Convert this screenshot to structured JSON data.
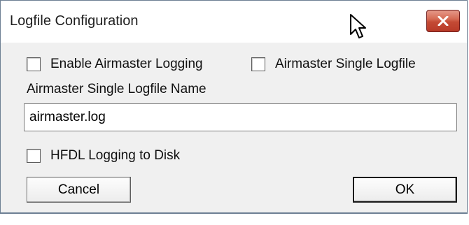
{
  "window": {
    "title": "Logfile Configuration"
  },
  "options": {
    "enable_logging": {
      "label": "Enable Airmaster Logging",
      "checked": false
    },
    "single_logfile": {
      "label": "Airmaster Single Logfile",
      "checked": false
    },
    "hfdl_logging": {
      "label": "HFDL Logging to Disk",
      "checked": false
    }
  },
  "logfile_name": {
    "label": "Airmaster Single Logfile Name",
    "value": "airmaster.log"
  },
  "buttons": {
    "cancel": "Cancel",
    "ok": "OK"
  },
  "colors": {
    "close_button": "#c44a35",
    "dialog_background": "#f0f0f0",
    "titlebar": "#ffffff"
  },
  "icons": {
    "close": "close-icon",
    "cursor": "mouse-cursor-icon"
  }
}
